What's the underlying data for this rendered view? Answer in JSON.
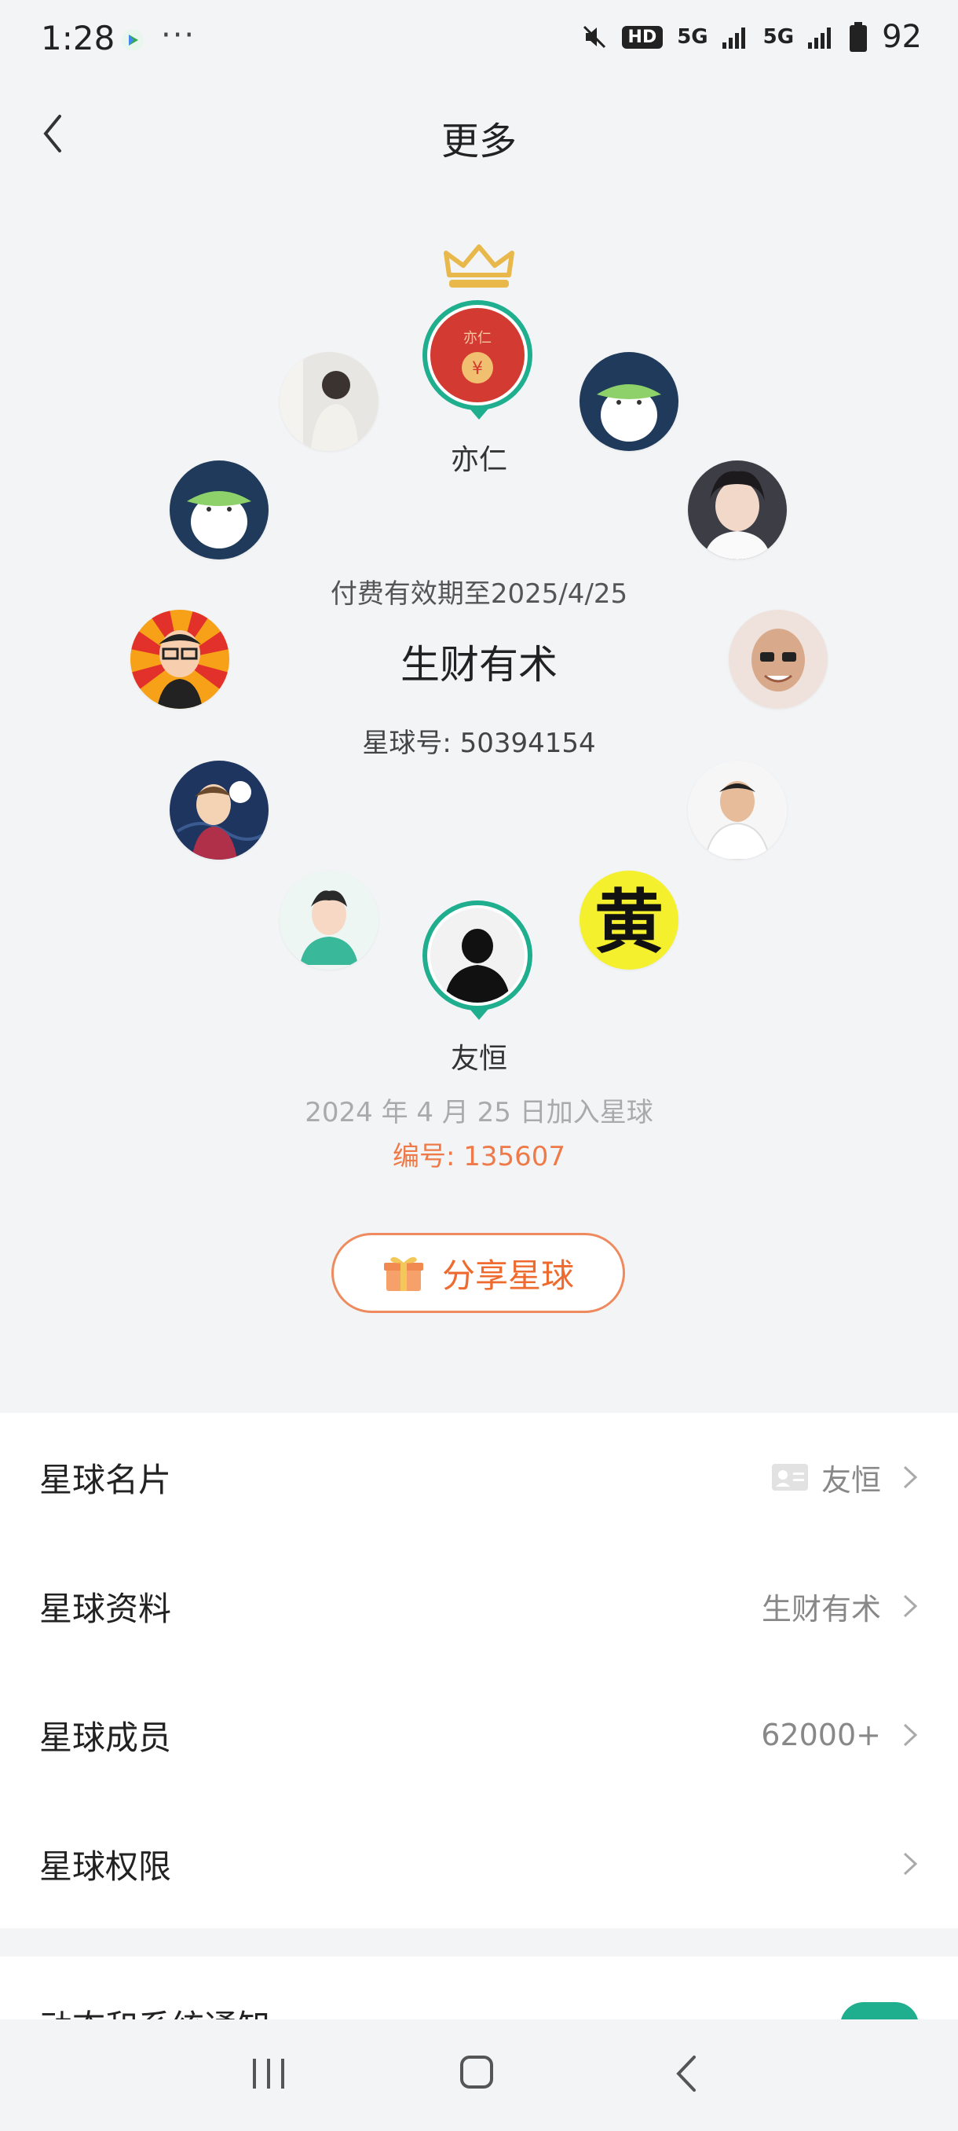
{
  "status_bar": {
    "time": "1:28",
    "dots": "···",
    "hd": "HD",
    "net1": "5G",
    "net2": "5G",
    "battery": "92"
  },
  "header": {
    "title": "更多"
  },
  "circle": {
    "owner_name": "亦仁",
    "owner_avatar_text": "亦仁",
    "expiry": "付费有效期至2025/4/25",
    "group_name": "生财有术",
    "group_id": "星球号: 50394154",
    "member_name": "友恒",
    "join_date": "2024 年 4 月 25 日加入星球",
    "member_no": "编号: 135607",
    "yellow_avatar_char": "黄"
  },
  "share": {
    "label": "分享星球"
  },
  "settings": [
    {
      "label": "星球名片",
      "value": "友恒",
      "icon": "card-icon"
    },
    {
      "label": "星球资料",
      "value": "生财有术"
    },
    {
      "label": "星球成员",
      "value": "62000+"
    },
    {
      "label": "星球权限",
      "value": ""
    }
  ],
  "cut_row": {
    "label": "动态和系统通知"
  },
  "colors": {
    "accent_green": "#1fae8e",
    "share_orange": "#ee6a2e",
    "red_avatar": "#d33a32"
  }
}
